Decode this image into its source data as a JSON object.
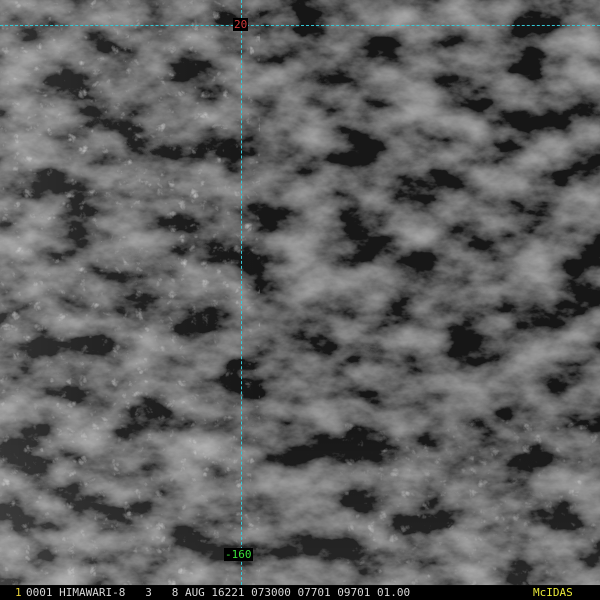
{
  "image": {
    "description_icon": "satellite-cloud-imagery",
    "overlay_color": "#33c8d6"
  },
  "gridlines": {
    "latitude_label": "20",
    "longitude_label": "-160",
    "latitude_label_color": "#d23a3a",
    "longitude_label_color": "#3ae03a"
  },
  "status_bar": {
    "frame_number": "1",
    "header": "0001 HIMAWARI-8   3   8 AUG 16221 073000 07701 09701 01.00",
    "brand": "McIDAS",
    "frame_number_color": "#e8d23a",
    "header_color": "#d8d8d8",
    "brand_color": "#e8e83a"
  }
}
